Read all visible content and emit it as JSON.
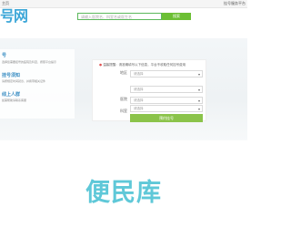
{
  "topbar": {
    "left": "主页",
    "right": "挂号服务平台"
  },
  "logo": {
    "text": "号网"
  },
  "search": {
    "placeholder": "请输入医院名、科室名或医生名",
    "button": "搜索"
  },
  "left_panel": {
    "sections": [
      {
        "title": "号",
        "text": "选择您需要挂号的医院及科室，按照平台提示"
      },
      {
        "title": "挂号须知",
        "text": "请按规定时间就诊，并携带相关证件"
      },
      {
        "title": "线上人群",
        "text": "如需帮助请联系客服"
      }
    ]
  },
  "form": {
    "notice": "温馨提醒：请准确填写以下信息，平台不收取任何挂号费用",
    "fields": [
      {
        "label": "地区",
        "value": "请选择"
      },
      {
        "label": "",
        "value": "请选择"
      },
      {
        "label": "医院",
        "value": "请选择"
      },
      {
        "label": "科室",
        "value": "请选择"
      }
    ],
    "submit": "预约挂号"
  },
  "brand": {
    "text": "便民库"
  }
}
